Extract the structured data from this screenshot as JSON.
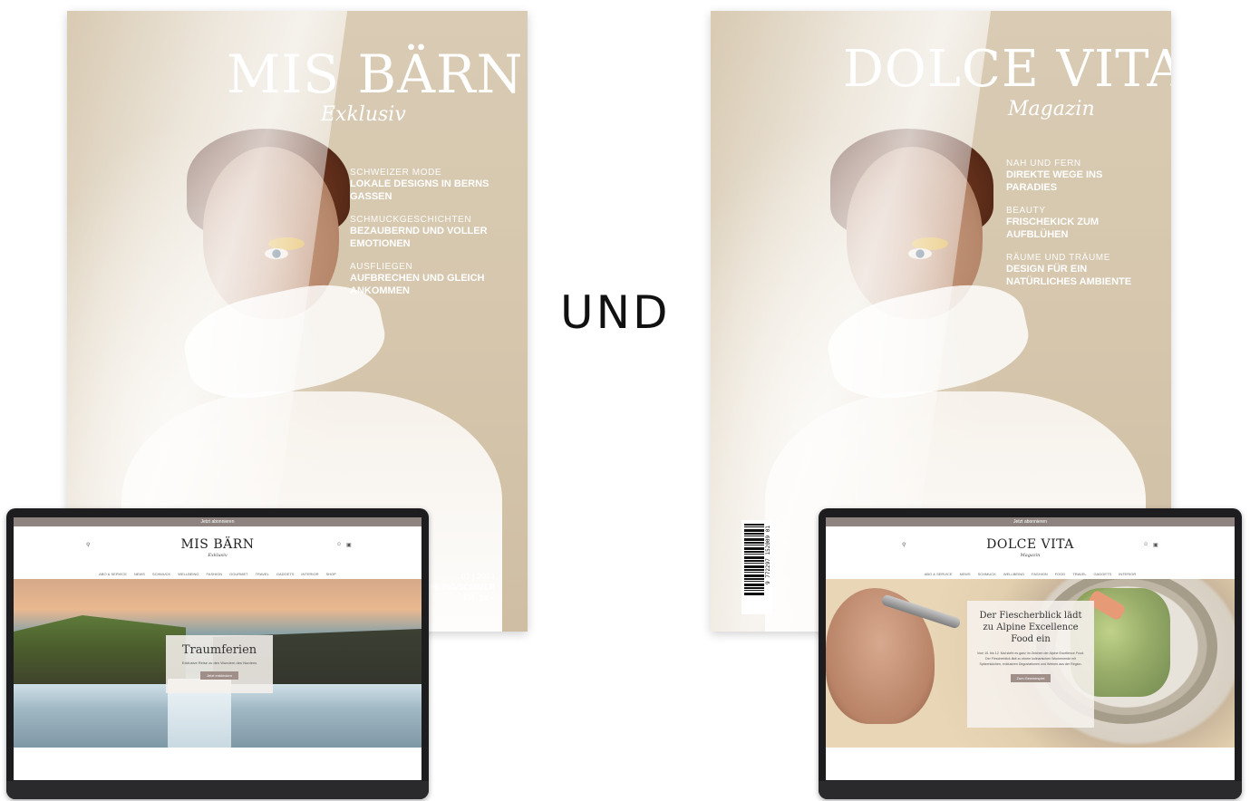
{
  "covers": {
    "left": {
      "title": "MIS BÄRN",
      "subtitle": "Exklusiv",
      "teasers": [
        {
          "kicker": "SCHWEIZER MODE",
          "headline": "LOKALE DESIGNS IN BERNS GASSEN"
        },
        {
          "kicker": "SCHMUCKGESCHICHTEN",
          "headline": "BEZAUBERND UND VOLLER EMOTIONEN"
        },
        {
          "kicker": "AUSFLIEGEN",
          "headline": "AUFBRECHEN UND GLEICH ANKOMMEN"
        }
      ],
      "issue": {
        "number": "01 | 2024",
        "season": "FRÜHLING/SOMMER",
        "price": "FR. 14.–"
      }
    },
    "right": {
      "title": "DOLCE VITA",
      "subtitle": "Magazin",
      "teasers": [
        {
          "kicker": "NAH UND FERN",
          "headline": "DIREKTE WEGE INS PARADIES"
        },
        {
          "kicker": "BEAUTY",
          "headline": "FRISCHEKICK ZUM AUFBLÜHEN"
        },
        {
          "kicker": "RÄUME UND TRÄUME",
          "headline": "DESIGN FÜR EIN NATÜRLICHES AMBIENTE"
        }
      ],
      "barcode_number": "9 772297 152009 01"
    }
  },
  "connector": "UND",
  "laptops": {
    "left": {
      "topbar": "Jetzt abonnieren",
      "logo": "MIS BÄRN",
      "logo_sub": "Exklusiv",
      "nav": [
        "ABO & SERVICE",
        "NEWS",
        "SCHMUCK",
        "WELLBEING",
        "FASHION",
        "GOURMET",
        "TRAVEL",
        "GADGETS",
        "INTERIOR",
        "SHOP"
      ],
      "hero_title": "Traumferien",
      "hero_text": "Exklusive Reise zu den Wundern des Nordens",
      "hero_button": "Jetzt entdecken"
    },
    "right": {
      "topbar": "Jetzt abonnieren",
      "logo": "DOLCE VITA",
      "logo_sub": "Magazin",
      "nav": [
        "ABO & SERVICE",
        "NEWS",
        "SCHMUCK",
        "WELLBEING",
        "FASHION",
        "FOOD",
        "TRAVEL",
        "GADGETS",
        "INTERIOR"
      ],
      "hero_title": "Der Fiescherblick lädt zu Alpine Excellence Food ein",
      "hero_text": "Vom 10. bis 12. Mai steht es ganz im Zeichen der Alpine Excellence Food. Der Fiescherblick lädt zu einem kulinarischen Wochenende mit Spitzenköchen, exklusiven Degustationen und Weinen aus der Region.",
      "hero_button": "Zum Gewinnspiel"
    }
  },
  "icons": {
    "search": "search-icon",
    "user": "user-icon",
    "cart": "cart-icon"
  }
}
